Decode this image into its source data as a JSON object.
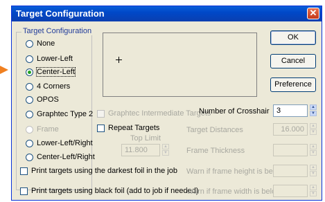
{
  "window": {
    "title": "Target Configuration",
    "close_glyph": "✕"
  },
  "group": {
    "label": "Target Configuration",
    "options": [
      {
        "label": "None",
        "checked": false,
        "disabled": false
      },
      {
        "label": "Lower-Left",
        "checked": false,
        "disabled": false
      },
      {
        "label": "Center-Left",
        "checked": true,
        "disabled": false
      },
      {
        "label": "4 Corners",
        "checked": false,
        "disabled": false
      },
      {
        "label": "OPOS",
        "checked": false,
        "disabled": false
      },
      {
        "label": "Graphtec Type 2",
        "checked": false,
        "disabled": false
      },
      {
        "label": "Frame",
        "checked": false,
        "disabled": true
      },
      {
        "label": "Lower-Left/Right",
        "checked": false,
        "disabled": false
      },
      {
        "label": "Center-Left/Right",
        "checked": false,
        "disabled": false
      }
    ]
  },
  "buttons": {
    "ok": "OK",
    "cancel": "Cancel",
    "preference": "Preference"
  },
  "graphtec_intermediate": {
    "label": "Graphtec Intermediate Targets"
  },
  "crosshair": {
    "label": "Number of Crosshair",
    "value": "3"
  },
  "repeat_targets": {
    "label": "Repeat Targets"
  },
  "target_distances": {
    "label": "Target Distances",
    "value": "16.000"
  },
  "top_limit": {
    "label": "Top Limit",
    "value": "11.800"
  },
  "frame_thickness": {
    "label": "Frame Thickness"
  },
  "warn_height": {
    "label": "Warn if frame height is below"
  },
  "warn_width": {
    "label": "Warn if frame width is below"
  },
  "print_darkest": {
    "label": "Print targets using the darkest foil in the job"
  },
  "print_black": {
    "label": "Print targets using black foil (add to job if needed)"
  },
  "colors": {
    "title_blue": "#0048c8",
    "arrow_orange": "#f08020",
    "dialog_bg": "#ece9d8"
  }
}
